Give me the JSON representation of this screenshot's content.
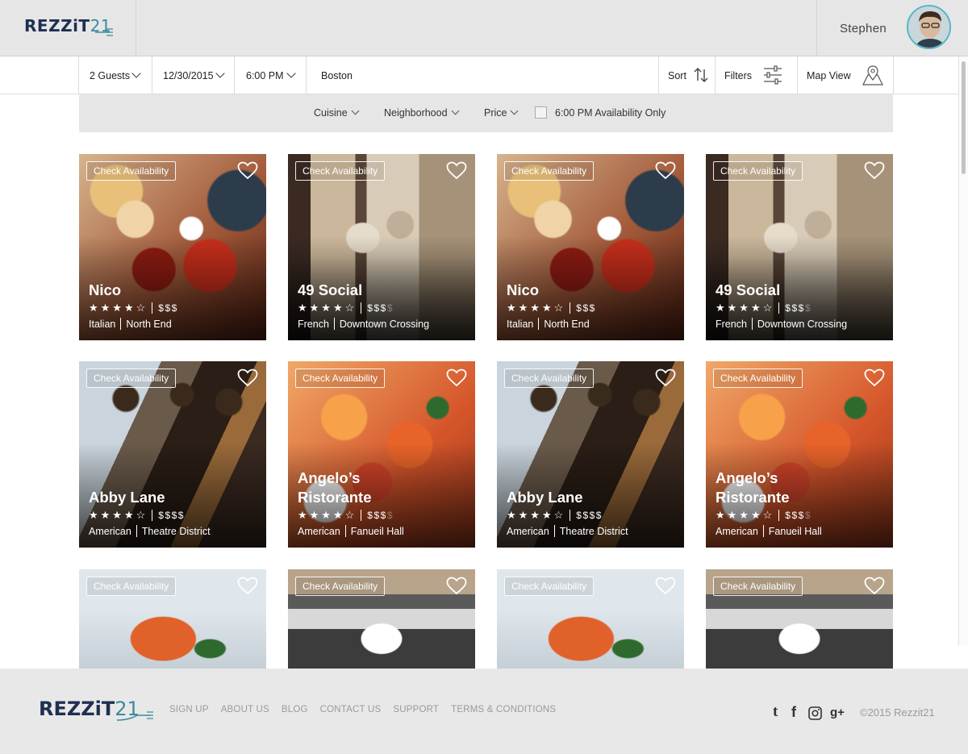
{
  "header": {
    "logo_text": "REZZiT",
    "logo_number": "21",
    "user_name": "Stephen"
  },
  "search": {
    "guests": "2 Guests",
    "date": "12/30/2015",
    "time": "6:00 PM",
    "location": "Boston",
    "sort_label": "Sort",
    "filters_label": "Filters",
    "map_label": "Map View"
  },
  "filters": {
    "cuisine": "Cuisine",
    "neighborhood": "Neighborhood",
    "price": "Price",
    "availability_only": "6:00 PM Availability Only",
    "availability_checked": false
  },
  "cards": [
    {
      "name": "Nico",
      "rating": 4,
      "price": "$$$",
      "price_dim": "",
      "cuisine": "Italian",
      "neighborhood": "North End",
      "check": "Check Availability",
      "image": "seafood"
    },
    {
      "name": "49 Social",
      "rating": 4,
      "price": "$$$",
      "price_dim": "$",
      "cuisine": "French",
      "neighborhood": "Downtown Crossing",
      "check": "Check Availability",
      "image": "dining-room"
    },
    {
      "name": "Nico",
      "rating": 4,
      "price": "$$$",
      "price_dim": "",
      "cuisine": "Italian",
      "neighborhood": "North End",
      "check": "Check Availability",
      "image": "seafood"
    },
    {
      "name": "49 Social",
      "rating": 4,
      "price": "$$$",
      "price_dim": "$",
      "cuisine": "French",
      "neighborhood": "Downtown Crossing",
      "check": "Check Availability",
      "image": "dining-room"
    },
    {
      "name": "Abby Lane",
      "rating": 4,
      "price": "$$$$",
      "price_dim": "",
      "cuisine": "American",
      "neighborhood": "Theatre District",
      "check": "Check Availability",
      "image": "bar"
    },
    {
      "name": "Angelo’s Ristorante",
      "rating": 4,
      "price": "$$$",
      "price_dim": "$",
      "cuisine": "American",
      "neighborhood": "Fanueil Hall",
      "check": "Check Availability",
      "image": "pasta"
    },
    {
      "name": "Abby Lane",
      "rating": 4,
      "price": "$$$$",
      "price_dim": "",
      "cuisine": "American",
      "neighborhood": "Theatre District",
      "check": "Check Availability",
      "image": "bar"
    },
    {
      "name": "Angelo’s Ristorante",
      "rating": 4,
      "price": "$$$",
      "price_dim": "$",
      "cuisine": "American",
      "neighborhood": "Fanueil Hall",
      "check": "Check Availability",
      "image": "pasta"
    },
    {
      "name": "",
      "rating": 0,
      "price": "",
      "price_dim": "",
      "cuisine": "",
      "neighborhood": "",
      "check": "Check Availability",
      "image": "shrimp"
    },
    {
      "name": "",
      "rating": 0,
      "price": "",
      "price_dim": "",
      "cuisine": "",
      "neighborhood": "",
      "check": "Check Availability",
      "image": "banquet"
    },
    {
      "name": "",
      "rating": 0,
      "price": "",
      "price_dim": "",
      "cuisine": "",
      "neighborhood": "",
      "check": "Check Availability",
      "image": "shrimp"
    },
    {
      "name": "",
      "rating": 0,
      "price": "",
      "price_dim": "",
      "cuisine": "",
      "neighborhood": "",
      "check": "Check Availability",
      "image": "banquet"
    }
  ],
  "footer": {
    "links": [
      "SIGN UP",
      "ABOUT US",
      "BLOG",
      "CONTACT US",
      "SUPPORT",
      "TERMS & CONDITIONS"
    ],
    "social": [
      "tumblr-icon",
      "facebook-icon",
      "instagram-icon",
      "google-plus-icon"
    ],
    "copyright": "©2015 Rezzit21"
  },
  "colors": {
    "brand_navy": "#1f2f52",
    "brand_teal": "#3b8a9a",
    "header_bg": "#e6e6e6"
  }
}
